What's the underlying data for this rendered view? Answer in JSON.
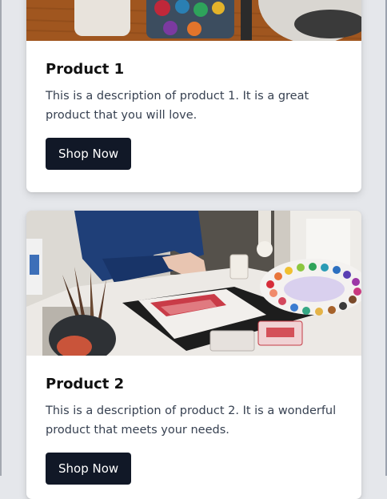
{
  "products": [
    {
      "title": "Product 1",
      "description": "This is a description of product 1. It is a great product that you will love.",
      "button_label": "Shop Now",
      "image_alt": "paint palette photo"
    },
    {
      "title": "Product 2",
      "description": "This is a description of product 2. It is a wonderful product that meets your needs.",
      "button_label": "Shop Now",
      "image_alt": "painter at desk with watercolor palette photo"
    }
  ],
  "colors": {
    "page_background": "#e5e7eb",
    "card_background": "#ffffff",
    "button_background": "#111827",
    "button_text": "#ffffff",
    "title_text": "#111111",
    "description_text": "#374151"
  }
}
